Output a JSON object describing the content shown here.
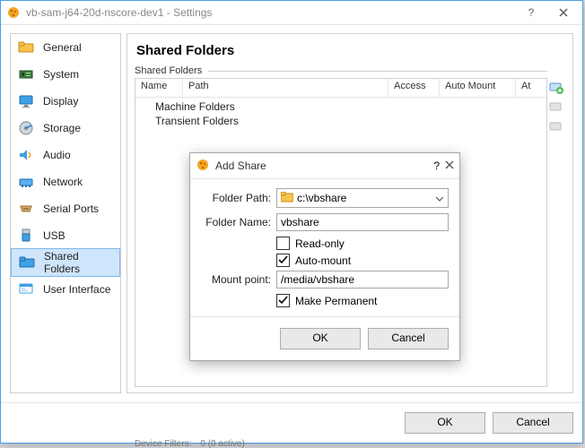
{
  "window": {
    "title": "vb-sam-j64-20d-nscore-dev1 - Settings"
  },
  "sidebar": {
    "items": [
      {
        "label": "General"
      },
      {
        "label": "System"
      },
      {
        "label": "Display"
      },
      {
        "label": "Storage"
      },
      {
        "label": "Audio"
      },
      {
        "label": "Network"
      },
      {
        "label": "Serial Ports"
      },
      {
        "label": "USB"
      },
      {
        "label": "Shared Folders"
      },
      {
        "label": "User Interface"
      }
    ],
    "selected_index": 8
  },
  "pane": {
    "header": "Shared Folders",
    "group_label": "Shared Folders",
    "columns": {
      "name": "Name",
      "path": "Path",
      "access": "Access",
      "auto": "Auto Mount",
      "at": "At"
    },
    "rows": [
      {
        "label": "Machine Folders"
      },
      {
        "label": "Transient Folders"
      }
    ]
  },
  "dialog": {
    "title": "Add Share",
    "labels": {
      "folder_path": "Folder Path:",
      "folder_name": "Folder Name:",
      "mount_point": "Mount point:"
    },
    "values": {
      "folder_path": "c:\\vbshare",
      "folder_name": "vbshare",
      "mount_point": "/media/vbshare"
    },
    "checks": {
      "read_only": {
        "label": "Read-only",
        "checked": false
      },
      "auto_mount": {
        "label": "Auto-mount",
        "checked": true
      },
      "make_permanent": {
        "label": "Make Permanent",
        "checked": true
      }
    },
    "buttons": {
      "ok": "OK",
      "cancel": "Cancel"
    }
  },
  "footer": {
    "ok": "OK",
    "cancel": "Cancel"
  },
  "status": {
    "device_filters_label": "Device Filters:",
    "device_filters_value": "0 (0 active)"
  }
}
